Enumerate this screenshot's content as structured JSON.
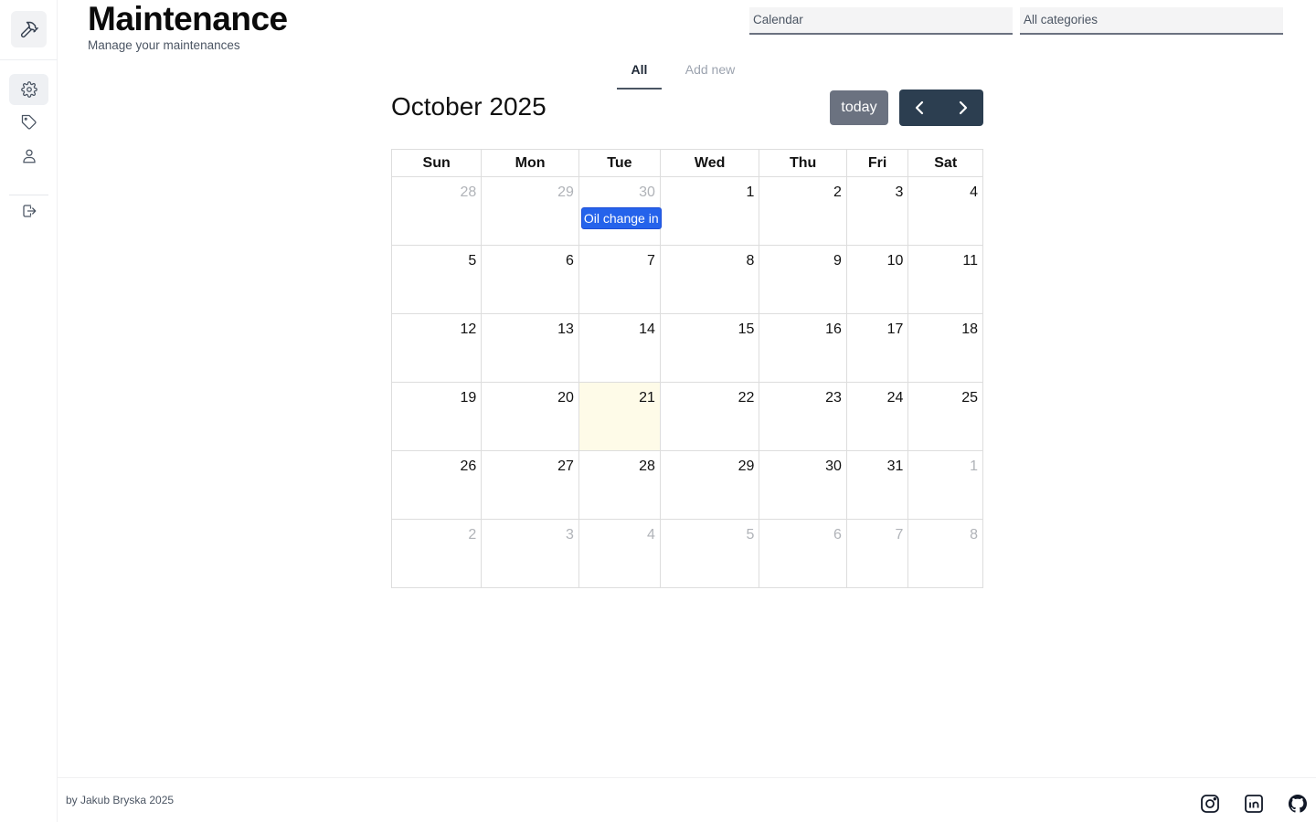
{
  "header": {
    "title": "Maintenance",
    "subtitle": "Manage your maintenances"
  },
  "filters": {
    "calendar_select": "Calendar",
    "category_select": "All categories"
  },
  "tabs": [
    {
      "label": "All",
      "active": true
    },
    {
      "label": "Add new",
      "active": false
    }
  ],
  "sidebar": {
    "items": [
      {
        "icon": "gear-icon",
        "active": true
      },
      {
        "icon": "tag-icon",
        "active": false
      },
      {
        "icon": "user-icon",
        "active": false
      },
      {
        "icon": "logout-icon",
        "active": false
      }
    ]
  },
  "calendar": {
    "title": "October 2025",
    "today_label": "today",
    "weekdays": [
      "Sun",
      "Mon",
      "Tue",
      "Wed",
      "Thu",
      "Fri",
      "Sat"
    ],
    "weeks": [
      [
        {
          "d": "28",
          "o": true
        },
        {
          "d": "29",
          "o": true
        },
        {
          "d": "30",
          "o": true
        },
        {
          "d": "1"
        },
        {
          "d": "2"
        },
        {
          "d": "3"
        },
        {
          "d": "4"
        }
      ],
      [
        {
          "d": "5"
        },
        {
          "d": "6"
        },
        {
          "d": "7"
        },
        {
          "d": "8"
        },
        {
          "d": "9"
        },
        {
          "d": "10"
        },
        {
          "d": "11"
        }
      ],
      [
        {
          "d": "12"
        },
        {
          "d": "13"
        },
        {
          "d": "14"
        },
        {
          "d": "15"
        },
        {
          "d": "16"
        },
        {
          "d": "17"
        },
        {
          "d": "18"
        }
      ],
      [
        {
          "d": "19"
        },
        {
          "d": "20"
        },
        {
          "d": "21",
          "today": true
        },
        {
          "d": "22"
        },
        {
          "d": "23"
        },
        {
          "d": "24"
        },
        {
          "d": "25"
        }
      ],
      [
        {
          "d": "26"
        },
        {
          "d": "27"
        },
        {
          "d": "28"
        },
        {
          "d": "29"
        },
        {
          "d": "30"
        },
        {
          "d": "31"
        },
        {
          "d": "1",
          "o": true
        }
      ],
      [
        {
          "d": "2",
          "o": true
        },
        {
          "d": "3",
          "o": true
        },
        {
          "d": "4",
          "o": true
        },
        {
          "d": "5",
          "o": true
        },
        {
          "d": "6",
          "o": true
        },
        {
          "d": "7",
          "o": true
        },
        {
          "d": "8",
          "o": true
        }
      ]
    ],
    "events": [
      {
        "label": "Oil change in",
        "week": 0,
        "day": 2
      }
    ]
  },
  "footer": {
    "credit": "by Jakub Bryska 2025",
    "social": [
      "instagram-icon",
      "linkedin-icon",
      "github-icon"
    ]
  },
  "colors": {
    "primary_dark": "#2c3e50",
    "today_button": "#6b7280",
    "event": "#2563eb",
    "today_highlight": "#fefbe8"
  }
}
